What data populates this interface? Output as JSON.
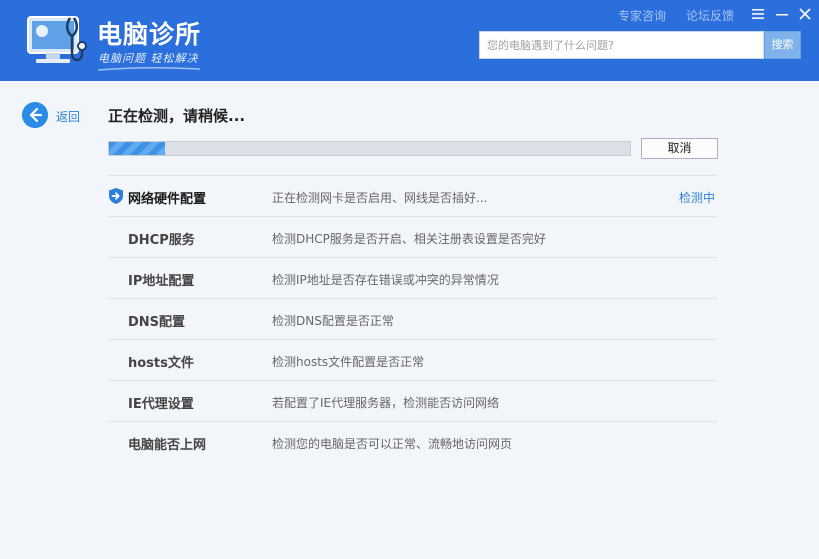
{
  "app": {
    "title": "电脑诊所",
    "slogan": "电脑问题 轻松解决"
  },
  "top_links": {
    "expert": "专家咨询",
    "forum": "论坛反馈"
  },
  "search": {
    "placeholder": "您的电脑遇到了什么问题?",
    "button_label": "搜索"
  },
  "nav": {
    "back_label": "返回"
  },
  "scan": {
    "status_title": "正在检测，请稍候...",
    "progress": 0.107,
    "cancel_label": "取消"
  },
  "checks": [
    {
      "name": "网络硬件配置",
      "desc": "正在检测网卡是否启用、网线是否插好...",
      "status": "检测中",
      "active": true
    },
    {
      "name": "DHCP服务",
      "desc": "检测DHCP服务是否开启、相关注册表设置是否完好",
      "status": ""
    },
    {
      "name": "IP地址配置",
      "desc": "检测IP地址是否存在错误或冲突的异常情况",
      "status": ""
    },
    {
      "name": "DNS配置",
      "desc": "检测DNS配置是否正常",
      "status": ""
    },
    {
      "name": "hosts文件",
      "desc": "检测hosts文件配置是否正常",
      "status": ""
    },
    {
      "name": "IE代理设置",
      "desc": "若配置了IE代理服务器，检测能否访问网络",
      "status": ""
    },
    {
      "name": "电脑能否上网",
      "desc": "检测您的电脑是否可以正常、流畅地访问网页",
      "status": ""
    }
  ],
  "colors": {
    "header": "#2b6fdd",
    "accent": "#2b7fd8",
    "progress": "#3d92e6"
  },
  "icons": {
    "logo": "monitor-stethoscope-icon",
    "back": "arrow-left-icon",
    "active_row": "shield-arrow-icon",
    "menu": "menu-icon",
    "minimize": "minimize-icon",
    "close": "close-icon"
  }
}
